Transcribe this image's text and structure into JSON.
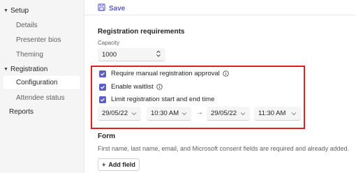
{
  "sidebar": {
    "groups": [
      {
        "label": "Setup",
        "children": [
          "Details",
          "Presenter bios",
          "Theming"
        ]
      },
      {
        "label": "Registration",
        "children": [
          "Configuration",
          "Attendee status"
        ]
      }
    ],
    "reports_label": "Reports",
    "selected": "Configuration"
  },
  "toolbar": {
    "save_label": "Save"
  },
  "registration": {
    "title": "Registration requirements",
    "capacity_label": "Capacity",
    "capacity_value": "1000",
    "options": [
      {
        "label": "Require manual registration approval",
        "checked": true,
        "info": true
      },
      {
        "label": "Enable waitlist",
        "checked": true,
        "info": true
      },
      {
        "label": "Limit registration start and end time",
        "checked": true,
        "info": false
      }
    ],
    "start_date": "29/05/22",
    "start_time": "10:30 AM",
    "end_date": "29/05/22",
    "end_time": "11:30 AM"
  },
  "form": {
    "title": "Form",
    "description": "First name, last name, email, and Microsoft consent fields are required and already added.",
    "add_field_label": "Add field"
  },
  "colors": {
    "accent": "#5b5fc7",
    "highlight": "#e0201f"
  }
}
